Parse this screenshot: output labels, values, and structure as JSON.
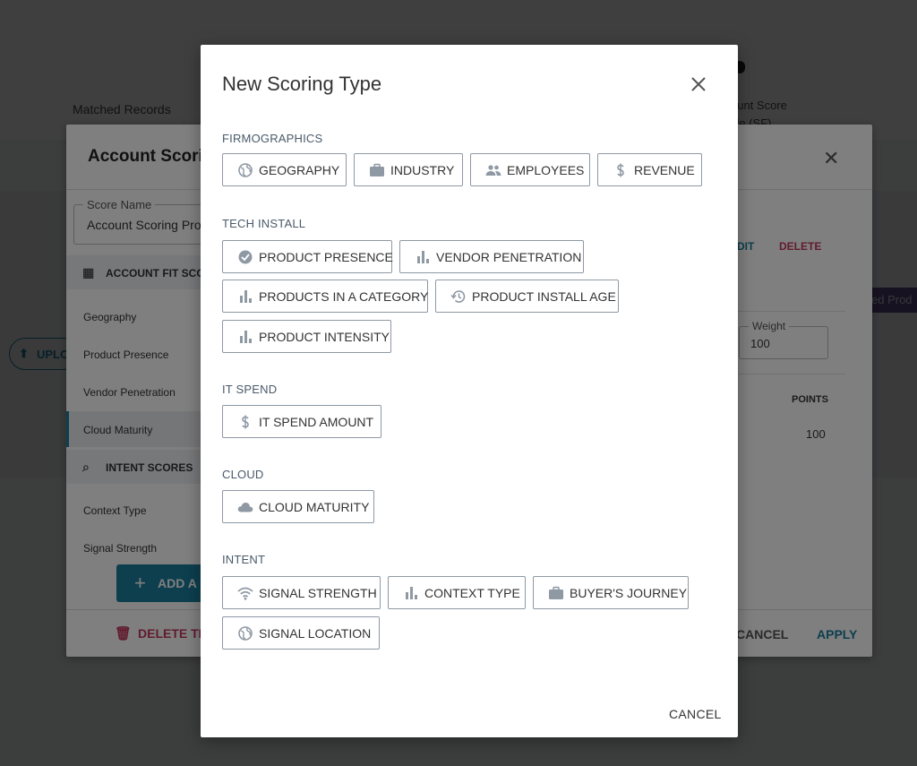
{
  "background_page": {
    "matched_records_label": "Matched Records",
    "account_score_label": "ount Score",
    "account_score_value": "file (SF)",
    "upload_button": "UPLO",
    "product_tag": "ed Prod"
  },
  "scoring_modal": {
    "title": "Account Scori",
    "score_name_label": "Score Name",
    "score_name_value": "Account Scoring Pro",
    "sections": {
      "account_fit": "ACCOUNT FIT SCOR",
      "intent": "INTENT SCORES"
    },
    "account_fit_items": [
      "Geography",
      "Product Presence",
      "Vendor Penetration",
      "Cloud Maturity"
    ],
    "intent_items": [
      "Context Type",
      "Signal Strength"
    ],
    "edit_label": "DIT",
    "delete_label": "DELETE",
    "weight_label": "Weight",
    "weight_value": "100",
    "points_header": "POINTS",
    "points_value": "100",
    "add_button": "ADD A",
    "delete_this_button": "DELETE TH",
    "cancel_button": "CANCEL",
    "apply_button": "APPLY",
    "accent_color": "#1a7f9c",
    "danger_color": "#c2385f"
  },
  "dialog": {
    "title": "New Scoring Type",
    "cancel_button": "CANCEL",
    "sections": [
      {
        "label": "FIRMOGRAPHICS",
        "options": [
          {
            "label": "GEOGRAPHY",
            "icon": "globe-icon"
          },
          {
            "label": "INDUSTRY",
            "icon": "briefcase-icon"
          },
          {
            "label": "EMPLOYEES",
            "icon": "people-icon"
          },
          {
            "label": "REVENUE",
            "icon": "dollar-icon"
          }
        ]
      },
      {
        "label": "TECH INSTALL",
        "options": [
          {
            "label": "PRODUCT PRESENCE",
            "icon": "check-circle-icon"
          },
          {
            "label": "VENDOR PENETRATION",
            "icon": "bar-chart-icon"
          },
          {
            "label": "PRODUCTS IN A CATEGORY",
            "icon": "bar-chart-icon"
          },
          {
            "label": "PRODUCT INSTALL AGE",
            "icon": "history-icon"
          },
          {
            "label": "PRODUCT INTENSITY",
            "icon": "bar-chart-icon"
          }
        ]
      },
      {
        "label": "IT SPEND",
        "options": [
          {
            "label": "IT SPEND AMOUNT",
            "icon": "dollar-icon"
          }
        ]
      },
      {
        "label": "CLOUD",
        "options": [
          {
            "label": "CLOUD MATURITY",
            "icon": "cloud-icon"
          }
        ]
      },
      {
        "label": "INTENT",
        "options": [
          {
            "label": "SIGNAL STRENGTH",
            "icon": "wifi-icon"
          },
          {
            "label": "CONTEXT TYPE",
            "icon": "bar-chart-icon"
          },
          {
            "label": "BUYER'S JOURNEY",
            "icon": "briefcase-icon"
          },
          {
            "label": "SIGNAL LOCATION",
            "icon": "globe-icon"
          }
        ]
      }
    ]
  }
}
